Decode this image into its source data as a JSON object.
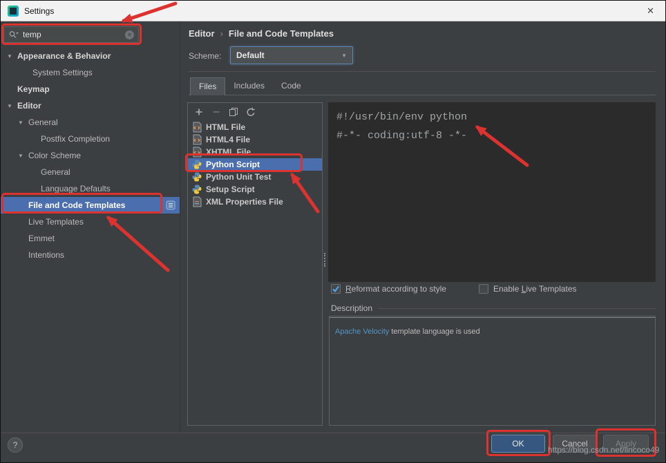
{
  "colors": {
    "annotation_red": "#dd3330",
    "selection_blue": "#4b6eaf",
    "ok_button_blue": "#365880",
    "editor_background": "#2b2b2b",
    "dialog_background": "#3c3f41"
  },
  "icons": {
    "chevron_down": "▼",
    "combo_arrow": "▼",
    "clear": "✕"
  },
  "window": {
    "title": "Settings",
    "close_icon": "✕"
  },
  "sidebar": {
    "search": {
      "value": "temp"
    },
    "items": [
      {
        "label": "Appearance & Behavior"
      },
      {
        "label": "System Settings"
      },
      {
        "label": "Keymap"
      },
      {
        "label": "Editor"
      },
      {
        "label": "General"
      },
      {
        "label": "Postfix Completion"
      },
      {
        "label": "Color Scheme"
      },
      {
        "label": "General"
      },
      {
        "label": "Language Defaults"
      },
      {
        "label": "File and Code Templates"
      },
      {
        "label": "Live Templates"
      },
      {
        "label": "Emmet"
      },
      {
        "label": "Intentions"
      }
    ]
  },
  "main": {
    "breadcrumb": {
      "parent": "Editor",
      "separator": "›",
      "current": "File and Code Templates"
    },
    "scheme": {
      "label": "Scheme:",
      "value": "Default"
    },
    "tabs": [
      {
        "label": "Files"
      },
      {
        "label": "Includes"
      },
      {
        "label": "Code"
      }
    ],
    "templates": [
      {
        "label": "HTML File"
      },
      {
        "label": "HTML4 File"
      },
      {
        "label": "XHTML File"
      },
      {
        "label": "Python Script"
      },
      {
        "label": "Python Unit Test"
      },
      {
        "label": "Setup Script"
      },
      {
        "label": "XML Properties File"
      }
    ],
    "editor": {
      "line1": "#!/usr/bin/env python",
      "line2": "#-*- coding:utf-8 -*-"
    },
    "checkboxes": {
      "reformat": {
        "mnemonic": "R",
        "rest": "eformat according to style",
        "checked": true
      },
      "live": {
        "pre": "Enable ",
        "mnemonic": "L",
        "rest": "ive Templates",
        "checked": false
      }
    },
    "description": {
      "title": "Description",
      "keyword": "Apache Velocity",
      "text": " template language is used"
    }
  },
  "footer": {
    "help": "?",
    "ok": "OK",
    "cancel": "Cancel",
    "apply": "Apply"
  },
  "watermark": "https://blog.csdn.net/lincoco49"
}
